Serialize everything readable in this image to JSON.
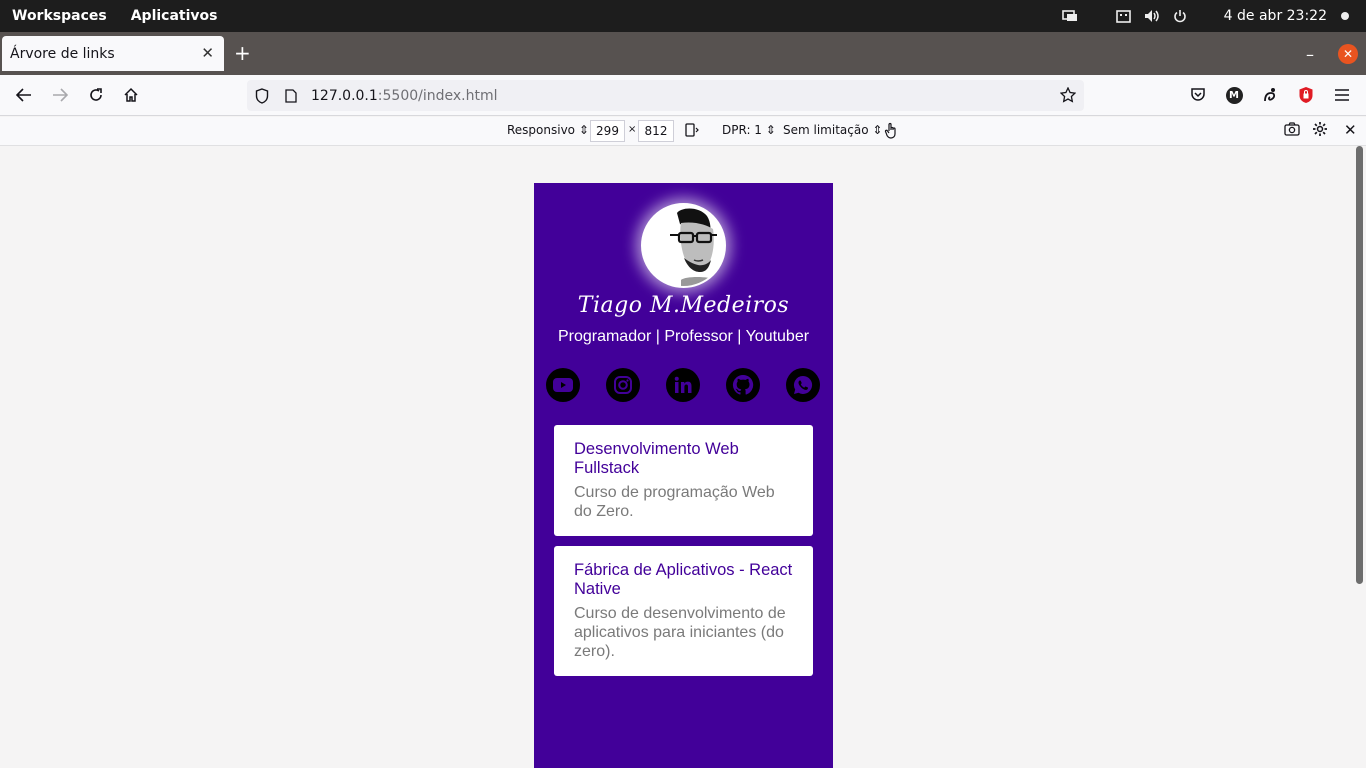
{
  "desktop": {
    "workspaces": "Workspaces",
    "apps": "Aplicativos",
    "clock": "4 de abr  23:22",
    "tray_icons": [
      "display-icon",
      "keyboard-icon",
      "volume-icon",
      "power-icon"
    ]
  },
  "browser": {
    "tab_title": "Árvore de links",
    "url_host": "127.0.0.1",
    "url_path": ":5500/index.html"
  },
  "rdm": {
    "device": "Responsivo",
    "width": "299",
    "times": "×",
    "height": "812",
    "dpr": "DPR: 1",
    "throttle": "Sem limitação"
  },
  "page": {
    "colors": {
      "background": "#420099",
      "card": "#ffffff",
      "card_title": "#420099",
      "card_desc": "#7a7a7a"
    },
    "profile_name": "Tiago M.Medeiros",
    "profile_role": "Programador | Professor | Youtuber",
    "social": [
      {
        "name": "youtube-icon"
      },
      {
        "name": "instagram-icon"
      },
      {
        "name": "linkedin-icon"
      },
      {
        "name": "github-icon"
      },
      {
        "name": "whatsapp-icon"
      }
    ],
    "links": [
      {
        "title": "Desenvolvimento Web Fullstack",
        "description": "Curso de programação Web do Zero."
      },
      {
        "title": "Fábrica de Aplicativos - React Native",
        "description": "Curso de desenvolvimento de aplicativos para iniciantes (do zero)."
      }
    ]
  }
}
